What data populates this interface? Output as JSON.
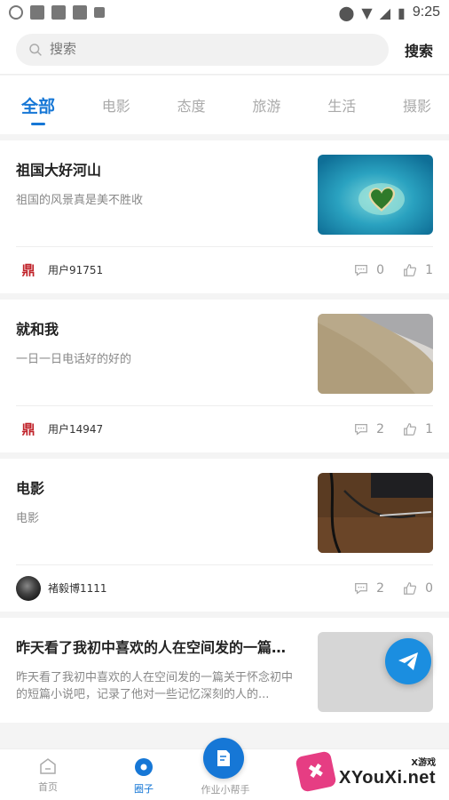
{
  "status_bar": {
    "time": "9:25"
  },
  "search": {
    "placeholder": "搜索",
    "button_label": "搜索"
  },
  "tabs": [
    {
      "label": "全部",
      "active": true
    },
    {
      "label": "电影",
      "active": false
    },
    {
      "label": "态度",
      "active": false
    },
    {
      "label": "旅游",
      "active": false
    },
    {
      "label": "生活",
      "active": false
    },
    {
      "label": "摄影",
      "active": false
    }
  ],
  "posts": [
    {
      "title": "祖国大好河山",
      "desc": "祖国的风景真是美不胜收",
      "user": "用户91751",
      "comments": "0",
      "likes": "1",
      "thumb": "island"
    },
    {
      "title": "就和我",
      "desc": "一日一日电话好的好的",
      "user": "用户14947",
      "comments": "2",
      "likes": "1",
      "thumb": "fabric"
    },
    {
      "title": "电影",
      "desc": "电影",
      "user": "褚毅博1111",
      "comments": "2",
      "likes": "0",
      "thumb": "desk"
    },
    {
      "title": "昨天看了我初中喜欢的人在空间发的一篇关...",
      "desc": "昨天看了我初中喜欢的人在空间发的一篇关于怀念初中的短篇小说吧，记录了他对一些记忆深刻的人的..."
    }
  ],
  "bottom_nav": [
    {
      "label": "首页",
      "icon": "home-icon"
    },
    {
      "label": "圈子",
      "icon": "circle-chat-icon"
    },
    {
      "label": "作业小帮手",
      "icon": "edit-doc-icon"
    }
  ],
  "watermark": {
    "small": "X游戏",
    "main": "XYouXi.net",
    "badge": "✖"
  },
  "colors": {
    "accent": "#1677d6",
    "fab": "#1b8ee0"
  }
}
